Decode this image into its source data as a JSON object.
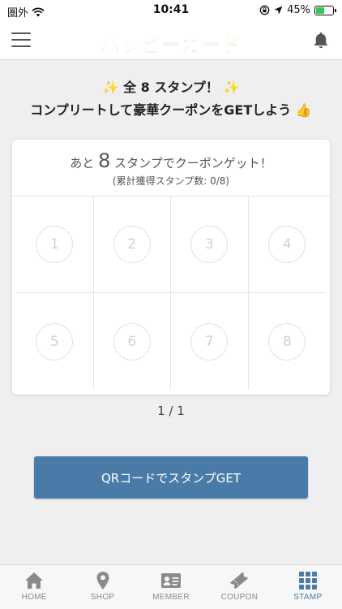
{
  "status_bar": {
    "carrier": "圏外",
    "time": "10:41",
    "battery_percent": "45%",
    "battery_level": 0.45
  },
  "header": {
    "logo_text": "ハッピーカード",
    "menu_icon": "hamburger-menu-icon",
    "bell_icon": "bell-icon"
  },
  "headline": {
    "line1": "全 8 スタンプ！",
    "line2": "コンプリートして豪華クーポンをGETしよう",
    "sparkle": "✨",
    "thumb": "👍"
  },
  "card": {
    "title_prefix": "あと",
    "remaining": "8",
    "title_suffix": "スタンプでクーポンゲット！",
    "subtitle": "(累計獲得スタンプ数: 0/8)",
    "stamps": [
      "1",
      "2",
      "3",
      "4",
      "5",
      "6",
      "7",
      "8"
    ]
  },
  "pager": "1 / 1",
  "qr_button_label": "QRコードでスタンプGET",
  "bottom_nav": {
    "items": [
      {
        "label": "HOME",
        "icon": "home-icon"
      },
      {
        "label": "SHOP",
        "icon": "map-pin-icon"
      },
      {
        "label": "MEMBER",
        "icon": "member-card-icon"
      },
      {
        "label": "COUPON",
        "icon": "ticket-icon"
      },
      {
        "label": "STAMP",
        "icon": "stamp-grid-icon"
      }
    ],
    "active": "STAMP"
  },
  "colors": {
    "accent": "#4a7ba8",
    "background": "#efefef",
    "battery_green": "#34c759"
  }
}
